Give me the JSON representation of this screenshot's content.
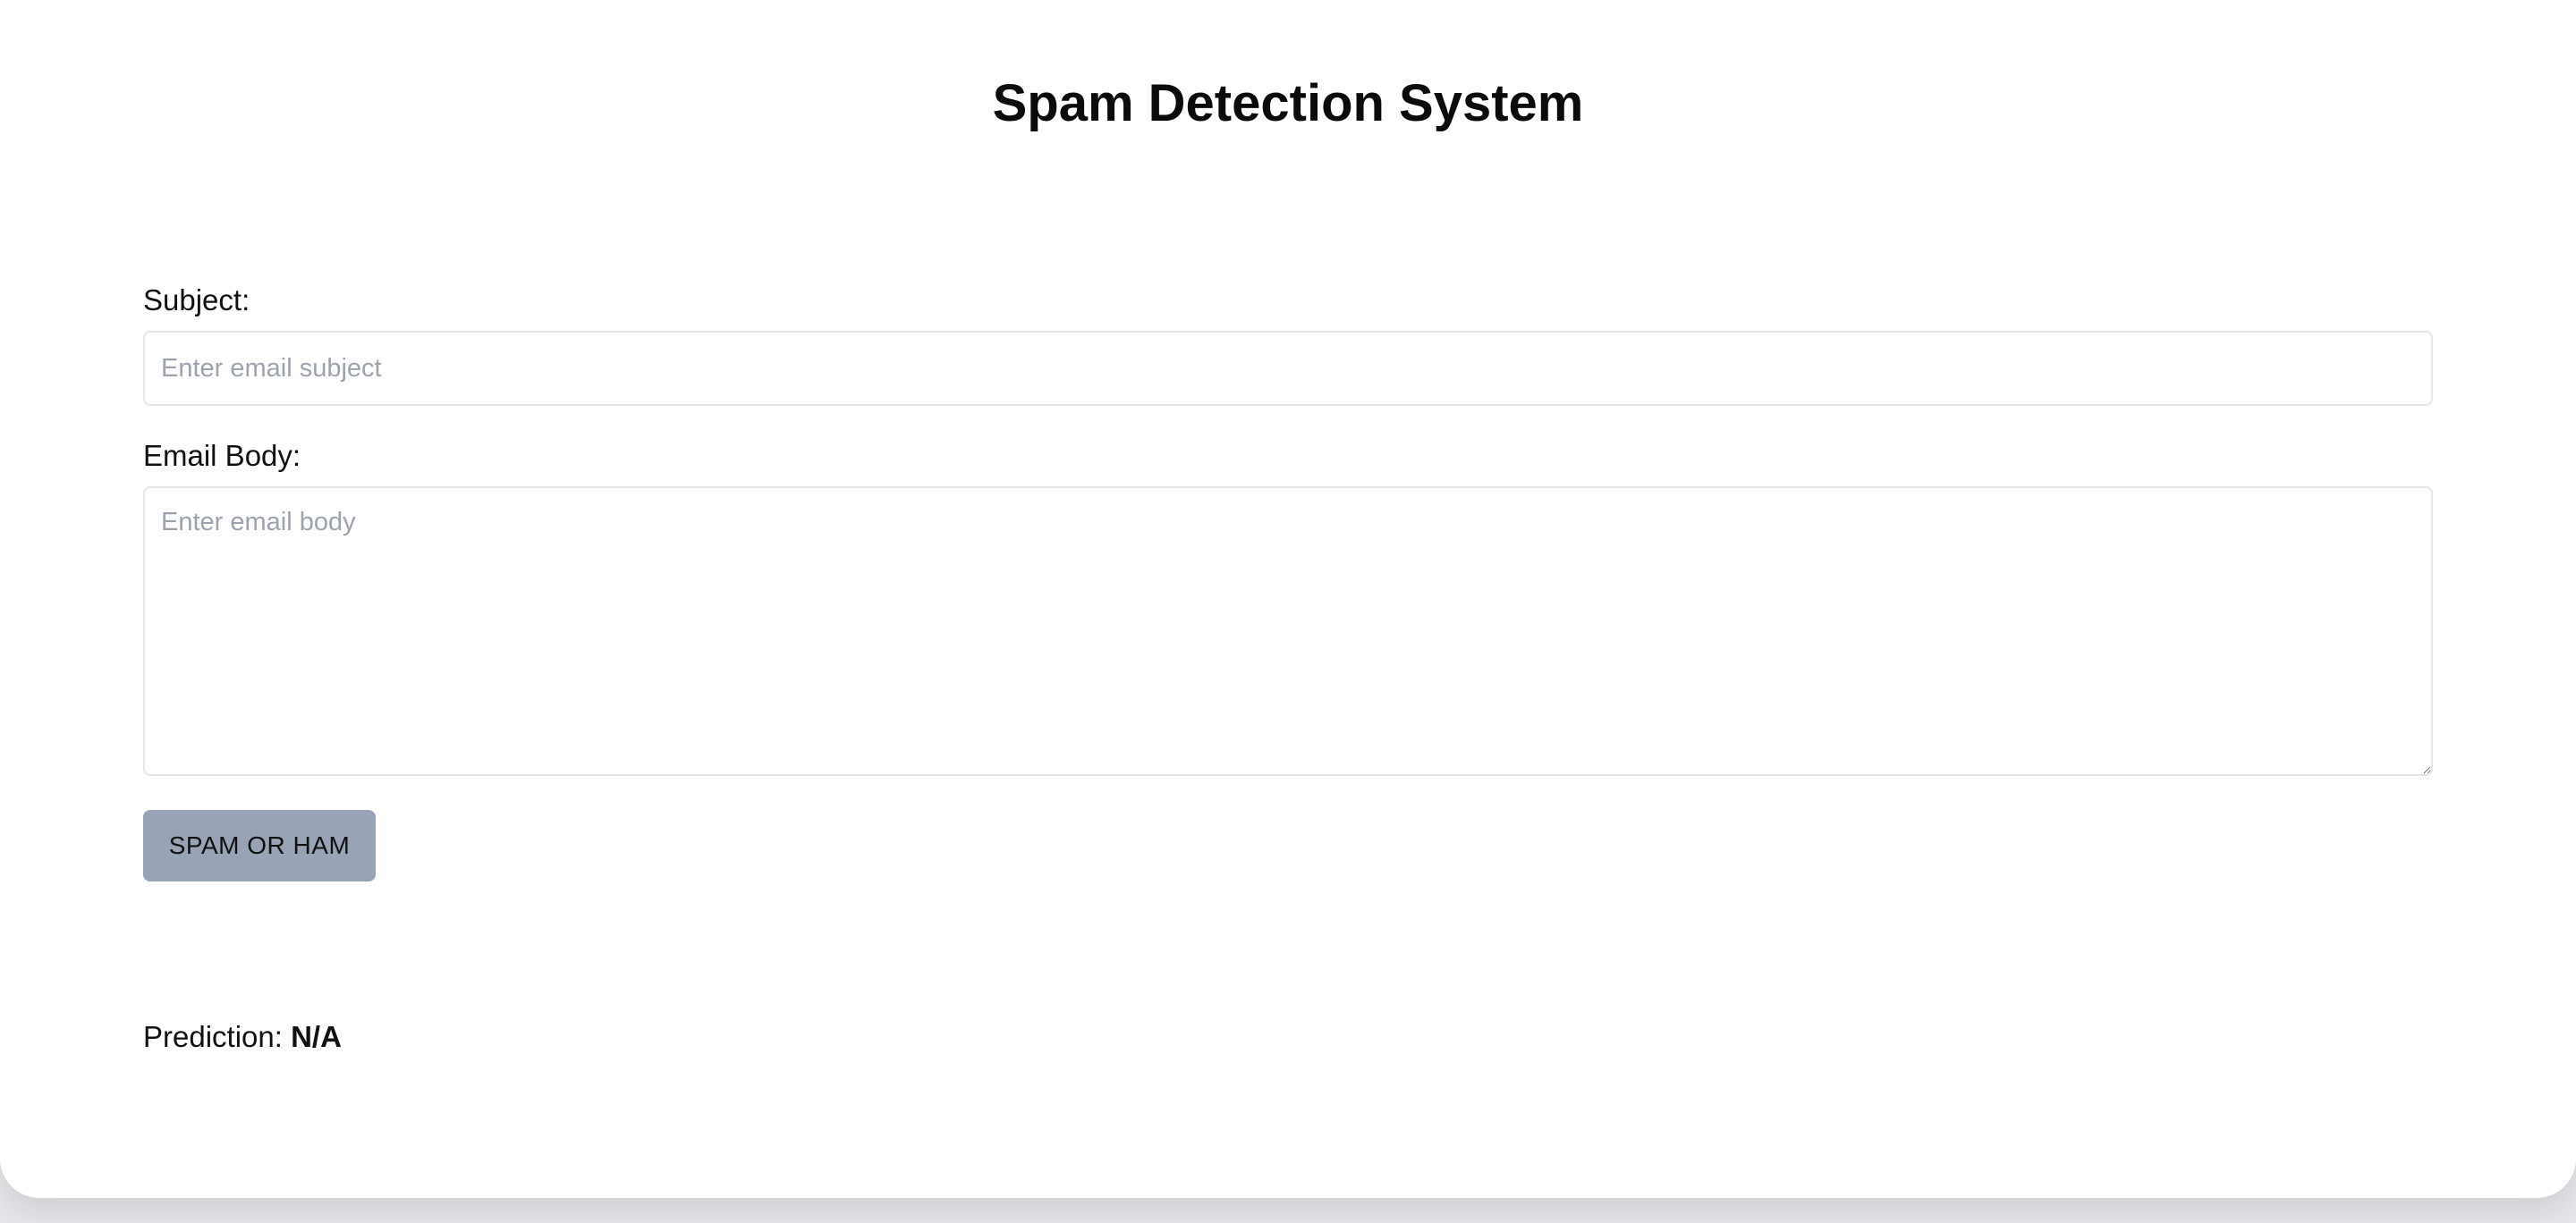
{
  "page": {
    "title": "Spam Detection System"
  },
  "form": {
    "subject_label": "Subject:",
    "subject_placeholder": "Enter email subject",
    "subject_value": "",
    "body_label": "Email Body:",
    "body_placeholder": "Enter email body",
    "body_value": "",
    "submit_label": "SPAM OR HAM"
  },
  "result": {
    "label": "Prediction:",
    "value": "N/A"
  },
  "colors": {
    "button_background": "#98a3b5",
    "input_border": "#e3e5e8",
    "placeholder_text": "#9ca3af"
  }
}
